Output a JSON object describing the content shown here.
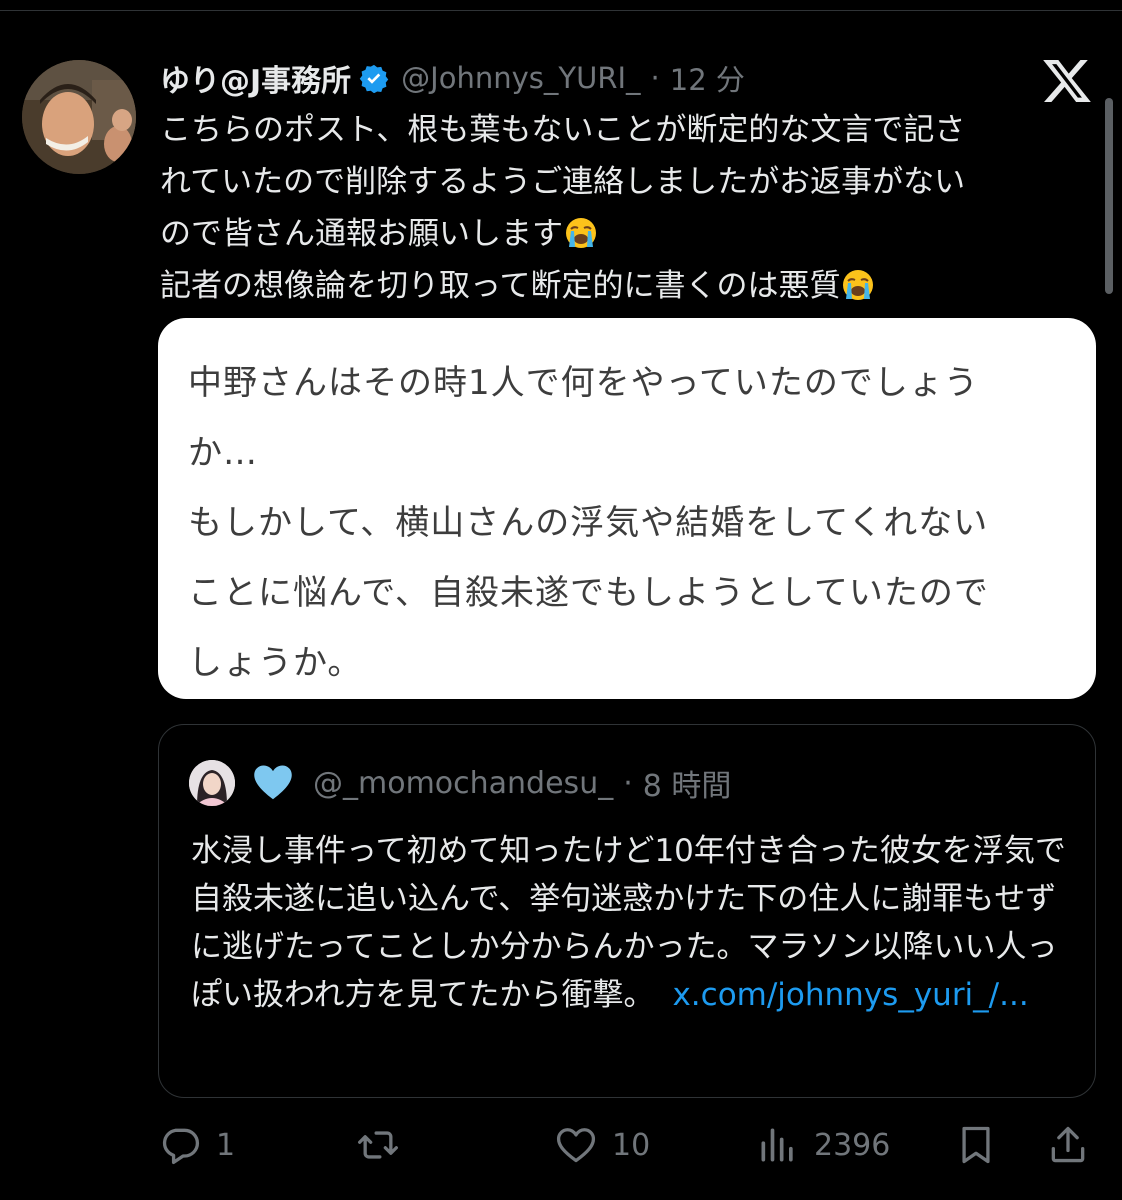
{
  "post": {
    "display_name": "ゆり@J事務所",
    "handle": "@Johnnys_YURI_",
    "dot": "·",
    "time": "12 分",
    "text_lines": [
      "こちらのポスト、根も葉もないことが断定的な文言で記さ",
      "れていたので削除するようご連絡しましたがお返事がない",
      "ので皆さん通報お願いします",
      "記者の想像論を切り取って断定的に書くのは悪質"
    ]
  },
  "image": {
    "lines": [
      "中野さんはその時1人で何をやっていたのでしょう",
      "か…",
      "もしかして、横山さんの浮気や結婚をしてくれない",
      "ことに悩んで、自殺未遂でもしようとしていたので",
      "しょうか。"
    ]
  },
  "quote": {
    "handle": "@_momochandesu_",
    "dot": "·",
    "time": "8 時間",
    "text": "水浸し事件って初めて知ったけど10年付き合った彼女を浮気で自殺未遂に追い込んで、挙句迷惑かけた下の住人に謝罪もせずに逃げたってことしか分からんかった。マラソン以降いい人っぽい扱われ方を見てたから衝撃。",
    "link": "x.com/johnnys_yuri_/..."
  },
  "actions": {
    "reply_count": "1",
    "retweet_count": "",
    "like_count": "10",
    "views_count": "2396"
  },
  "icons": {
    "verified": "verified-badge-icon",
    "x_logo": "x-logo-icon",
    "emoji": "loudly-crying-face-emoji",
    "quote_emoji": "light-blue-heart-emoji"
  },
  "colors": {
    "background": "#000000",
    "text": "#e7e9ea",
    "secondary": "#71767b",
    "link": "#1d9bf0",
    "verified": "#1d9bf0",
    "heart": "#7ec8f0"
  }
}
